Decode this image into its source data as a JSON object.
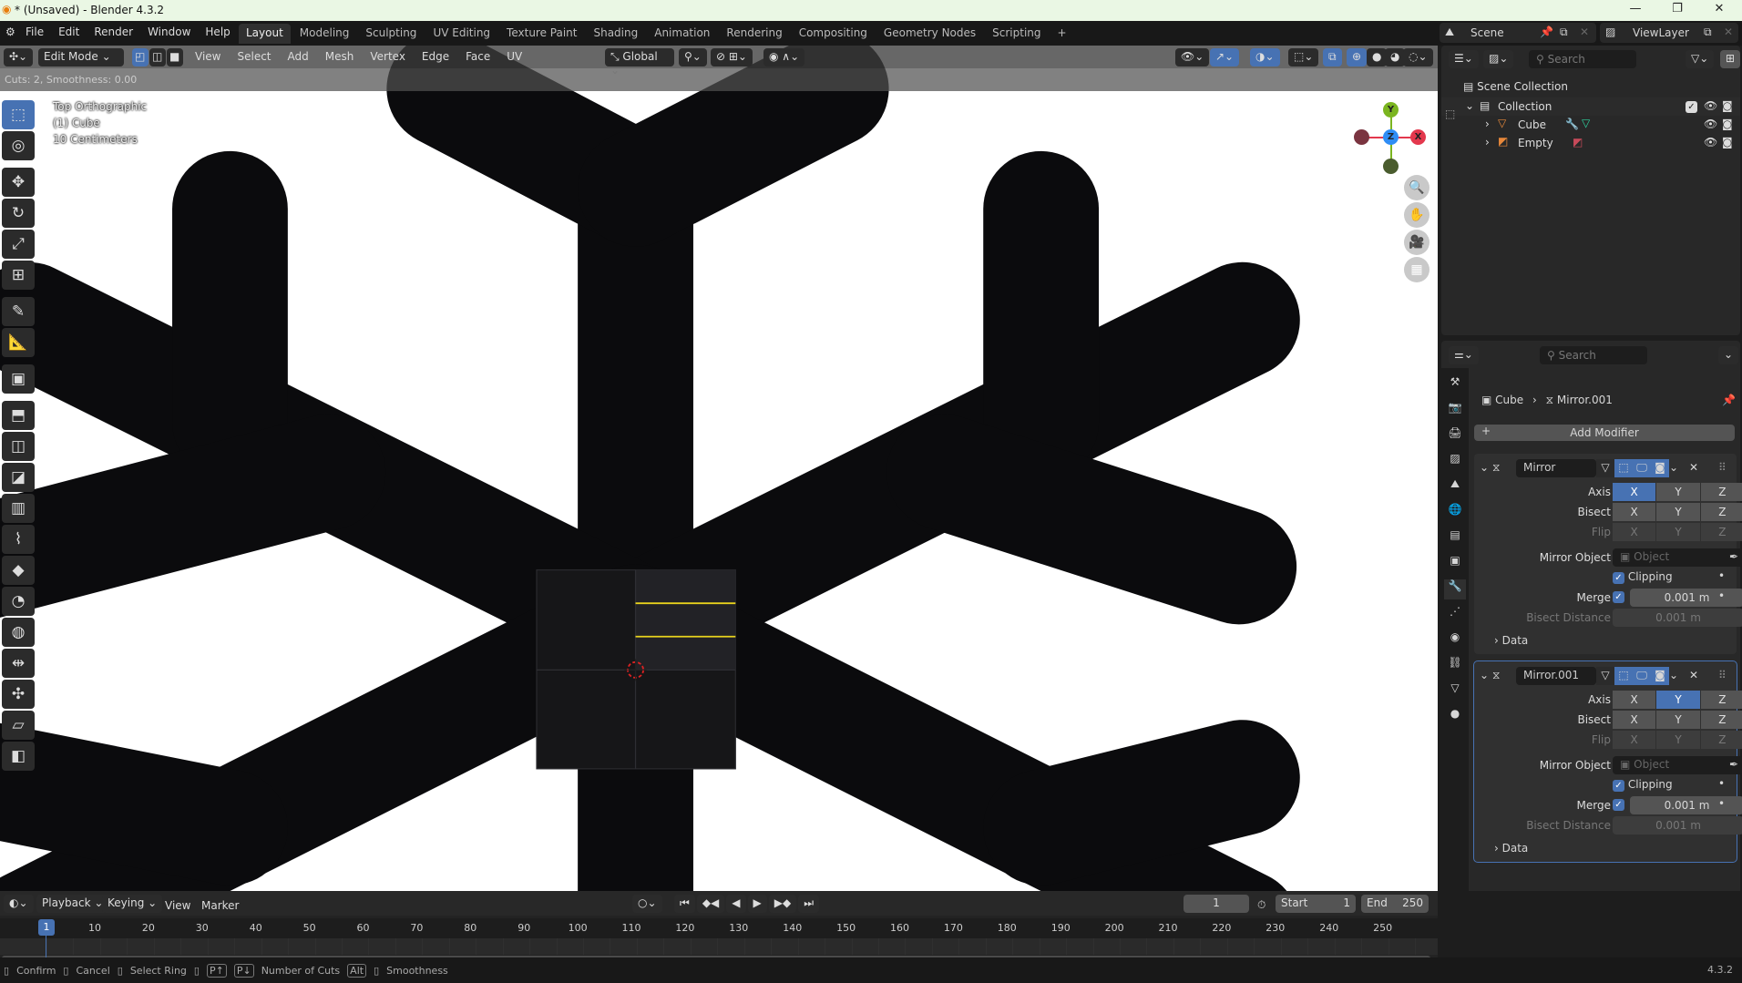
{
  "window": {
    "title": "* (Unsaved) - Blender 4.3.2",
    "minimize": "—",
    "maximize": "❐",
    "close": "✕"
  },
  "menu": {
    "items": [
      "File",
      "Edit",
      "Render",
      "Window",
      "Help"
    ],
    "workspaces": [
      "Layout",
      "Modeling",
      "Sculpting",
      "UV Editing",
      "Texture Paint",
      "Shading",
      "Animation",
      "Rendering",
      "Compositing",
      "Geometry Nodes",
      "Scripting"
    ],
    "active_workspace": "Layout",
    "add": "+",
    "scene": "Scene",
    "view_layer": "ViewLayer"
  },
  "viewport_header": {
    "mode": "Edit Mode",
    "menus": [
      "View",
      "Select",
      "Add",
      "Mesh",
      "Vertex",
      "Edge",
      "Face",
      "UV"
    ],
    "orientation": "Global"
  },
  "operator": {
    "text": "Cuts: 2, Smoothness: 0.00"
  },
  "overlay": {
    "view": "Top Orthographic",
    "object": "(1) Cube",
    "scale": "10 Centimeters"
  },
  "gizmo": {
    "x": "X",
    "y": "Y",
    "z": "Z",
    "colors": {
      "x": "#e3384d",
      "y": "#7bb520",
      "z": "#2f8df5"
    }
  },
  "toolbar": {
    "icons": [
      "select-box-icon",
      "cursor-icon",
      "move-icon",
      "rotate-icon",
      "scale-icon",
      "transform-icon",
      "annotate-icon",
      "measure-icon",
      "add-cube-icon",
      "extrude-icon",
      "inset-icon",
      "bevel-icon",
      "loop-cut-icon",
      "knife-icon",
      "poly-build-icon",
      "spin-icon",
      "smooth-icon",
      "edge-slide-icon",
      "shrink-fatten-icon",
      "shear-icon",
      "rip-icon"
    ],
    "glyphs": [
      "⬚",
      "◎",
      "✥",
      "↻",
      "⤢",
      "⊞",
      "✎",
      "📐",
      "▣",
      "⬒",
      "◫",
      "◪",
      "▥",
      "⌇",
      "◆",
      "◔",
      "◍",
      "⇹",
      "✣",
      "▱",
      "◧"
    ],
    "active": 0
  },
  "outliner": {
    "search_placeholder": "Search",
    "scene_collection": "Scene Collection",
    "collection": "Collection",
    "items": [
      {
        "name": "Cube"
      },
      {
        "name": "Empty"
      }
    ]
  },
  "properties": {
    "search_placeholder": "Search",
    "breadcrumb": {
      "object": "Cube",
      "modifier": "Mirror.001"
    },
    "add_modifier": "Add Modifier",
    "labels": {
      "axis": "Axis",
      "bisect": "Bisect",
      "flip": "Flip",
      "mirror_object": "Mirror Object",
      "object_placeholder": "Object",
      "clipping": "Clipping",
      "merge": "Merge",
      "bisect_distance": "Bisect Distance",
      "data": "Data"
    },
    "modifiers": [
      {
        "name": "Mirror",
        "axis": [
          "X",
          "Y",
          "Z"
        ],
        "axis_on": [
          true,
          false,
          false
        ],
        "bisect": [
          "X",
          "Y",
          "Z"
        ],
        "flip": [
          "X",
          "Y",
          "Z"
        ],
        "clipping": true,
        "merge": true,
        "merge_value": "0.001 m",
        "bisect_distance": "0.001 m"
      },
      {
        "name": "Mirror.001",
        "axis": [
          "X",
          "Y",
          "Z"
        ],
        "axis_on": [
          false,
          true,
          false
        ],
        "bisect": [
          "X",
          "Y",
          "Z"
        ],
        "flip": [
          "X",
          "Y",
          "Z"
        ],
        "clipping": true,
        "merge": true,
        "merge_value": "0.001 m",
        "bisect_distance": "0.001 m"
      }
    ]
  },
  "timeline": {
    "menus": [
      "Playback",
      "Keying",
      "View",
      "Marker"
    ],
    "current_frame": "1",
    "start_label": "Start",
    "start": "1",
    "end_label": "End",
    "end": "250",
    "ruler": [
      "10",
      "20",
      "30",
      "40",
      "50",
      "60",
      "70",
      "80",
      "90",
      "100",
      "110",
      "120",
      "130",
      "140",
      "150",
      "160",
      "170",
      "180",
      "190",
      "200",
      "210",
      "220",
      "230",
      "240",
      "250"
    ],
    "playhead": "1"
  },
  "status": {
    "items": [
      "Confirm",
      "Cancel",
      "Select Ring",
      "Number of Cuts",
      "Smoothness"
    ],
    "keys": [
      "P↑",
      "P↓",
      "Alt"
    ],
    "version": "4.3.2"
  }
}
